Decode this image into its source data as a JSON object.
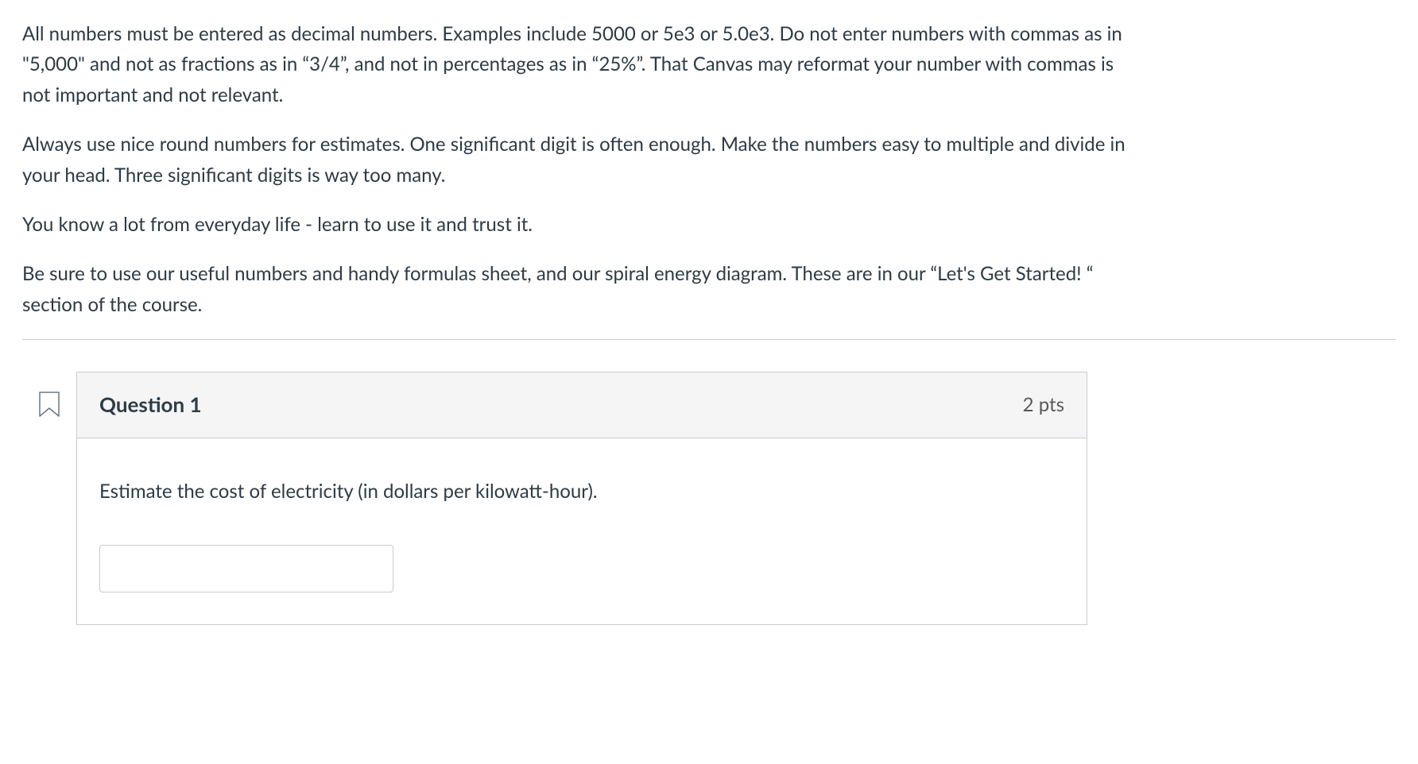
{
  "instructions": {
    "p1": "All numbers must be entered as decimal numbers. Examples include 5000 or 5e3 or 5.0e3. Do not enter numbers with commas as in \"5,000\" and not as fractions as in “3/4”, and not  in percentages as in “25%”. That Canvas may reformat your number with commas is not important and not relevant.",
    "p2": "Always use nice round numbers for estimates. One significant digit is often enough. Make the numbers easy to multiple and divide in your head. Three significant digits is way too many.",
    "p3": "You know a lot from everyday life - learn to use it and trust it.",
    "p4": "Be sure to use our useful numbers and handy formulas sheet, and our spiral energy diagram. These are in our “Let's Get Started! “ section of the course."
  },
  "question": {
    "title": "Question 1",
    "points": "2 pts",
    "text": "Estimate the cost of electricity (in dollars per kilowatt-hour).",
    "answer_value": ""
  }
}
